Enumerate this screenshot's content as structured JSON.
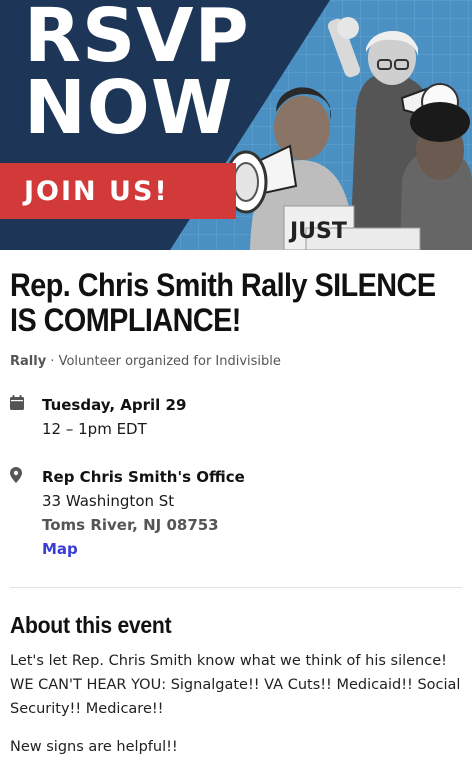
{
  "banner": {
    "headline": "RSVP\nNOW",
    "cta": "JOIN US!",
    "sign_text": "JUST",
    "colors": {
      "navy": "#1d3557",
      "red": "#d23a39",
      "blue": "#4a90c2"
    }
  },
  "event": {
    "title": "Rep. Chris Smith Rally SILENCE IS COMPLIANCE!",
    "type": "Rally",
    "organizer_text": " · Volunteer organized for Indivisible",
    "date": "Tuesday, April 29",
    "time": "12 – 1pm EDT",
    "location_name": "Rep Chris Smith's Office",
    "address_line1": "33 Washington St",
    "address_line2": "Toms River, NJ 08753",
    "map_link": "Map"
  },
  "about": {
    "heading": "About this event",
    "paragraph1": "Let's let Rep. Chris Smith know what we think of his silence! WE CAN'T HEAR YOU: Signalgate!! VA Cuts!! Medicaid!! Social Security!! Medicare!!",
    "paragraph2": "New signs are helpful!!"
  },
  "icons": [
    "calendar-icon",
    "location-pin-icon"
  ]
}
